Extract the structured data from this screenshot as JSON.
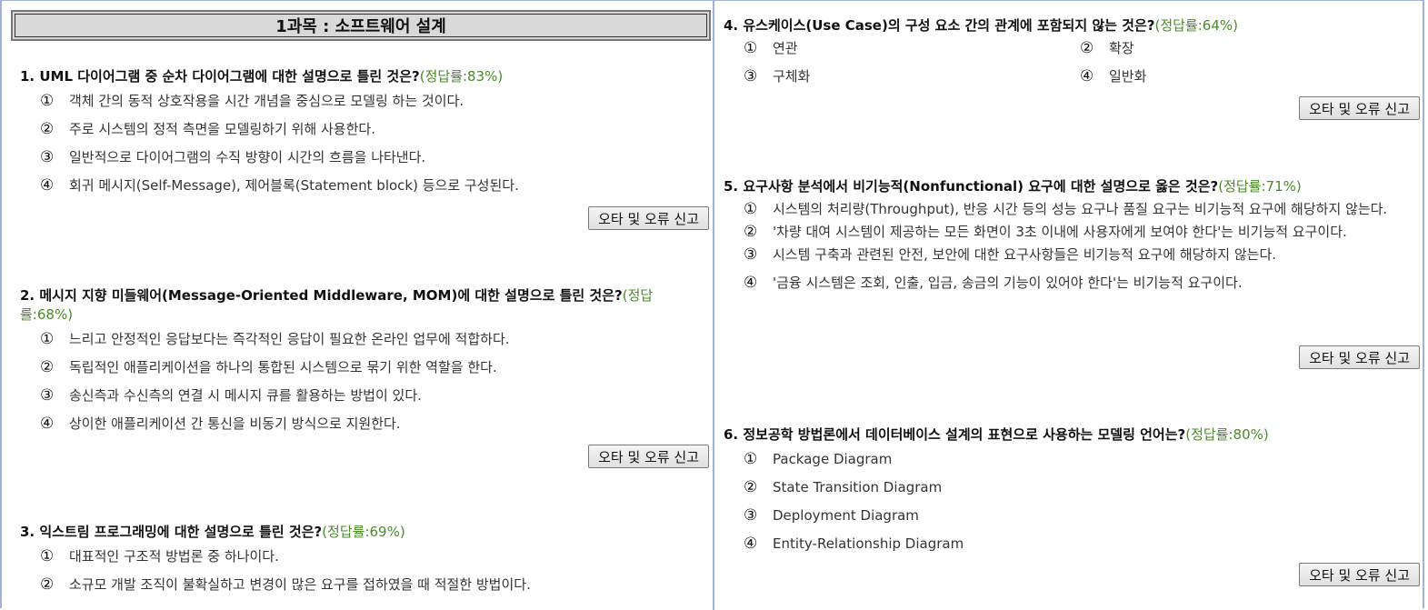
{
  "subject_title": "1과목 : 소프트웨어 설계",
  "report_label": "오타 및 오류 신고",
  "option_markers": [
    "①",
    "②",
    "③",
    "④"
  ],
  "questions": [
    {
      "num": "1.",
      "text": "UML 다이어그램 중 순차 다이어그램에 대한 설명으로 틀린 것은?",
      "rate": "(정답률:83%)",
      "options": [
        "객체 간의 동적 상호작용을 시간 개념을 중심으로 모델링 하는 것이다.",
        "주로 시스템의 정적 측면을 모델링하기 위해 사용한다.",
        "일반적으로 다이어그램의 수직 방향이 시간의 흐름을 나타낸다.",
        "회귀 메시지(Self-Message), 제어블록(Statement block) 등으로 구성된다."
      ]
    },
    {
      "num": "2.",
      "text": "메시지 지향 미들웨어(Message-Oriented Middleware, MOM)에 대한 설명으로 틀린 것은?",
      "rate": "(정답률:68%)",
      "options": [
        "느리고 안정적인 응답보다는 즉각적인 응답이 필요한 온라인 업무에 적합하다.",
        "독립적인 애플리케이션을 하나의 통합된 시스템으로 묶기 위한 역할을 한다.",
        "송신측과 수신측의 연결 시 메시지 큐를 활용하는 방법이 있다.",
        "상이한 애플리케이션 간 통신을 비동기 방식으로 지원한다."
      ]
    },
    {
      "num": "3.",
      "text": "익스트림 프로그래밍에 대한 설명으로 틀린 것은?",
      "rate": "(정답률:69%)",
      "options": [
        "대표적인 구조적 방법론 중 하나이다.",
        "소규모 개발 조직이 불확실하고 변경이 많은 요구를 접하였을 때 적절한 방법이다."
      ]
    },
    {
      "num": "4.",
      "text": "유스케이스(Use Case)의 구성 요소 간의 관계에 포함되지 않는 것은?",
      "rate": "(정답률:64%)",
      "options": [
        "연관",
        "확장",
        "구체화",
        "일반화"
      ]
    },
    {
      "num": "5.",
      "text": "요구사항 분석에서 비기능적(Nonfunctional) 요구에 대한 설명으로 옳은 것은?",
      "rate": "(정답률:71%)",
      "options": [
        "시스템의 처리량(Throughput), 반응 시간 등의 성능 요구나 품질 요구는 비기능적 요구에 해당하지 않는다.",
        "'차량 대여 시스템이 제공하는 모든 화면이 3초 이내에 사용자에게 보여야 한다'는 비기능적 요구이다.",
        "시스템 구축과 관련된 안전, 보안에 대한 요구사항들은 비기능적 요구에 해당하지 않는다.",
        "'금융 시스템은 조회, 인출, 입금, 송금의 기능이 있어야 한다'는 비기능적 요구이다."
      ]
    },
    {
      "num": "6.",
      "text": "정보공학 방법론에서 데이터베이스 설계의 표현으로 사용하는 모델링 언어는?",
      "rate": "(정답률:80%)",
      "options": [
        "Package Diagram",
        "State Transition Diagram",
        "Deployment Diagram",
        "Entity-Relationship Diagram"
      ]
    }
  ]
}
